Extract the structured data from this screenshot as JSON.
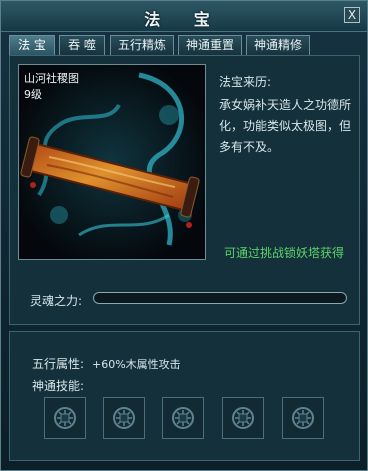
{
  "window": {
    "title": "法 宝",
    "close_label": "X"
  },
  "tabs": [
    "法 宝",
    "吞 噬",
    "五行精炼",
    "神通重置",
    "神通精修"
  ],
  "active_tab": "法 宝",
  "treasure": {
    "name": "山河社稷图",
    "level": "9级",
    "origin_label": "法宝来历:",
    "origin_text": "承女娲补天造人之功德所化，功能类似太极图，但多有不及。",
    "obtain_hint": "可通过挑战锁妖塔获得"
  },
  "soul": {
    "label": "灵魂之力:",
    "progress": 0
  },
  "attributes": {
    "element_label": "五行属性:",
    "element_value": "+60%木属性攻击",
    "skills_label": "神通技能:"
  },
  "skill_slots": [
    {
      "icon": "knot-pattern-icon"
    },
    {
      "icon": "knot-pattern-icon"
    },
    {
      "icon": "knot-pattern-icon"
    },
    {
      "icon": "knot-pattern-icon"
    },
    {
      "icon": "knot-pattern-icon"
    }
  ],
  "colors": {
    "accent": "#5ed36a",
    "panel": "#13303b",
    "title_bar": "#2e5866"
  }
}
